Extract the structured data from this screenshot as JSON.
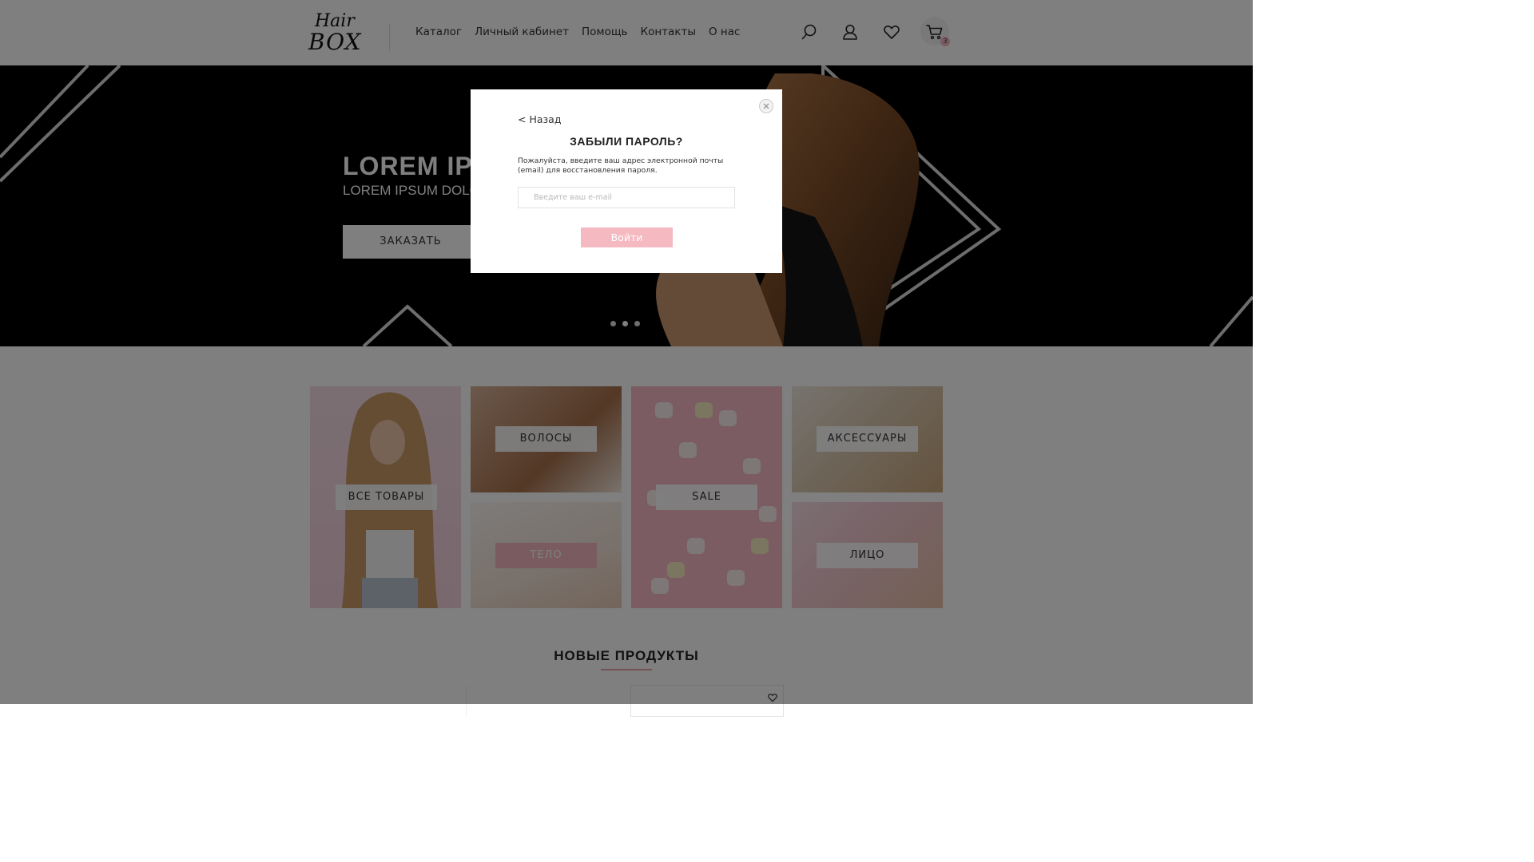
{
  "header": {
    "logo": {
      "line1": "Hair",
      "line2": "BOX"
    },
    "nav": [
      "Каталог",
      "Личный кабинет",
      "Помощь",
      "Контакты",
      "О нас"
    ],
    "icons": [
      "search-icon",
      "user-icon",
      "heart-icon",
      "cart-icon"
    ],
    "cart_count": "3"
  },
  "hero": {
    "title": "LOREM IPSUM",
    "subtitle": "LOREM IPSUM DOLOR",
    "button": "ЗАКАЗАТЬ",
    "slides": 3,
    "active_slide": 2
  },
  "categories": {
    "all": "ВСЕ ТОВАРЫ",
    "hair": "ВОЛОСЫ",
    "body": "ТЕЛО",
    "sale": "SALE",
    "accessories": "АКСЕССУАРЫ",
    "face": "ЛИЦО"
  },
  "new_products": {
    "title": "НОВЫЕ ПРОДУКТЫ"
  },
  "modal": {
    "back": "< Назад",
    "title": "ЗАБЫЛИ ПАРОЛЬ?",
    "description": "Пожалуйста, введите ваш адрес электронной почты (email) для восстановления пароля.",
    "input_placeholder": "Введите ваш e-mail",
    "input_value": "",
    "submit": "Войти"
  },
  "colors": {
    "accent_pink": "#f4b9c1",
    "hero_bg": "#000000",
    "overlay": "rgba(0,0,0,0.5)"
  }
}
